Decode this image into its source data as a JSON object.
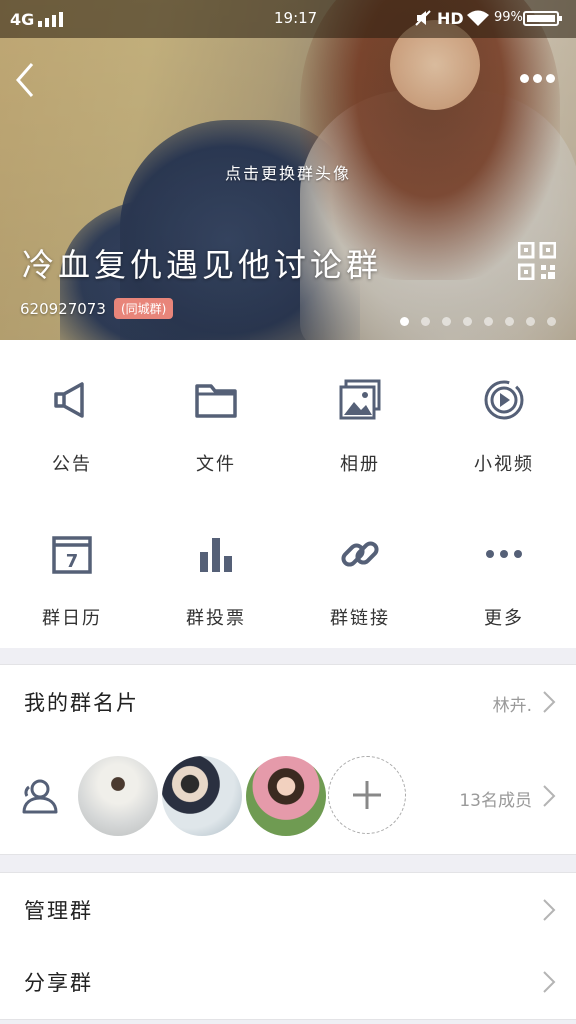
{
  "status_bar": {
    "network": "4G",
    "time": "19:17",
    "hd": "HD",
    "battery": "99%"
  },
  "header": {
    "change_avatar_hint": "点击更换群头像",
    "group_name": "冷血复仇遇见他讨论群",
    "group_id": "620927073",
    "city_tag": "(同城群)",
    "page_count": 8,
    "active_page": 1
  },
  "grid": [
    {
      "label": "公告",
      "icon": "megaphone-icon"
    },
    {
      "label": "文件",
      "icon": "folder-icon"
    },
    {
      "label": "相册",
      "icon": "album-icon"
    },
    {
      "label": "小视频",
      "icon": "video-icon"
    },
    {
      "label": "群日历",
      "icon": "calendar-icon",
      "calendar_day": "7"
    },
    {
      "label": "群投票",
      "icon": "bar-chart-icon"
    },
    {
      "label": "群链接",
      "icon": "link-icon"
    },
    {
      "label": "更多",
      "icon": "more-icon"
    }
  ],
  "rows": {
    "card": {
      "title": "我的群名片",
      "value": "林卉."
    },
    "members": {
      "value": "13名成员"
    },
    "manage": {
      "title": "管理群"
    },
    "share": {
      "title": "分享群"
    }
  },
  "colors": {
    "icon": "#556077",
    "tag": "#e8857a",
    "background": "#efeff4"
  }
}
